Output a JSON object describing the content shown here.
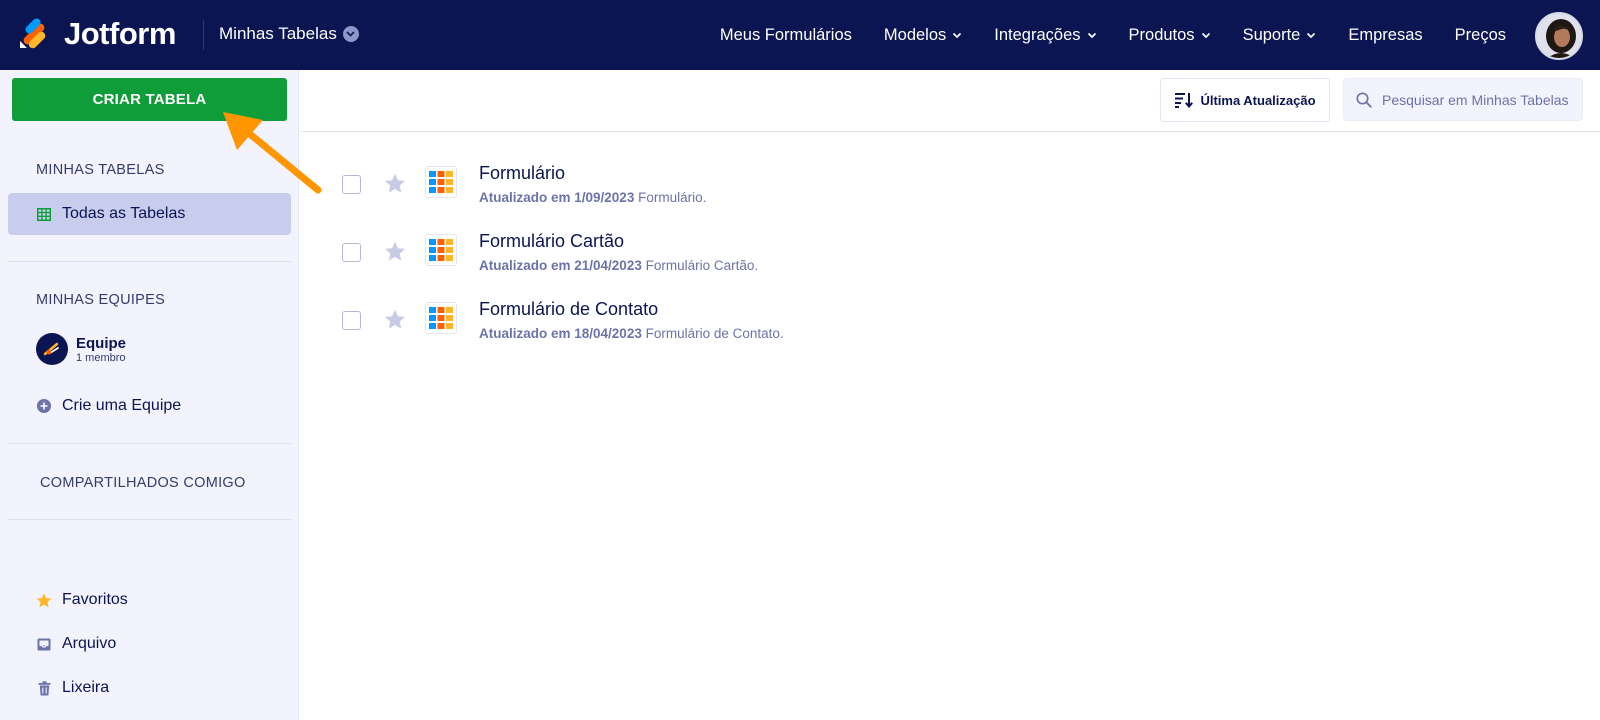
{
  "header": {
    "logo_text": "Jotform",
    "workspace": "Minhas Tabelas",
    "nav": [
      {
        "label": "Meus Formulários",
        "has_dropdown": false
      },
      {
        "label": "Modelos",
        "has_dropdown": true
      },
      {
        "label": "Integrações",
        "has_dropdown": true
      },
      {
        "label": "Produtos",
        "has_dropdown": true
      },
      {
        "label": "Suporte",
        "has_dropdown": true
      },
      {
        "label": "Empresas",
        "has_dropdown": false
      },
      {
        "label": "Preços",
        "has_dropdown": false
      }
    ]
  },
  "sidebar": {
    "create_button": "CRIAR TABELA",
    "my_tables_title": "MINHAS TABELAS",
    "all_tables": "Todas as Tabelas",
    "my_teams_title": "MINHAS EQUIPES",
    "team": {
      "name": "Equipe",
      "members": "1 membro"
    },
    "create_team": "Crie uma Equipe",
    "shared_title": "COMPARTILHADOS COMIGO",
    "favorites": "Favoritos",
    "archive": "Arquivo",
    "trash": "Lixeira"
  },
  "toolbar": {
    "sort_label": "Última Atualização",
    "search_placeholder": "Pesquisar em Minhas Tabelas"
  },
  "tables": [
    {
      "title": "Formulário",
      "updated": "Atualizado em 1/09/2023",
      "source": "Formulário."
    },
    {
      "title": "Formulário Cartão",
      "updated": "Atualizado em 21/04/2023",
      "source": "Formulário Cartão."
    },
    {
      "title": "Formulário de Contato",
      "updated": "Atualizado em 18/04/2023",
      "source": "Formulário de Contato."
    }
  ],
  "colors": {
    "navbar": "#0a1551",
    "create_button": "#0f9d3a",
    "sidebar_bg": "#f3f3fe",
    "active_item": "#c8cdee",
    "annotation_arrow": "#ff9500"
  }
}
